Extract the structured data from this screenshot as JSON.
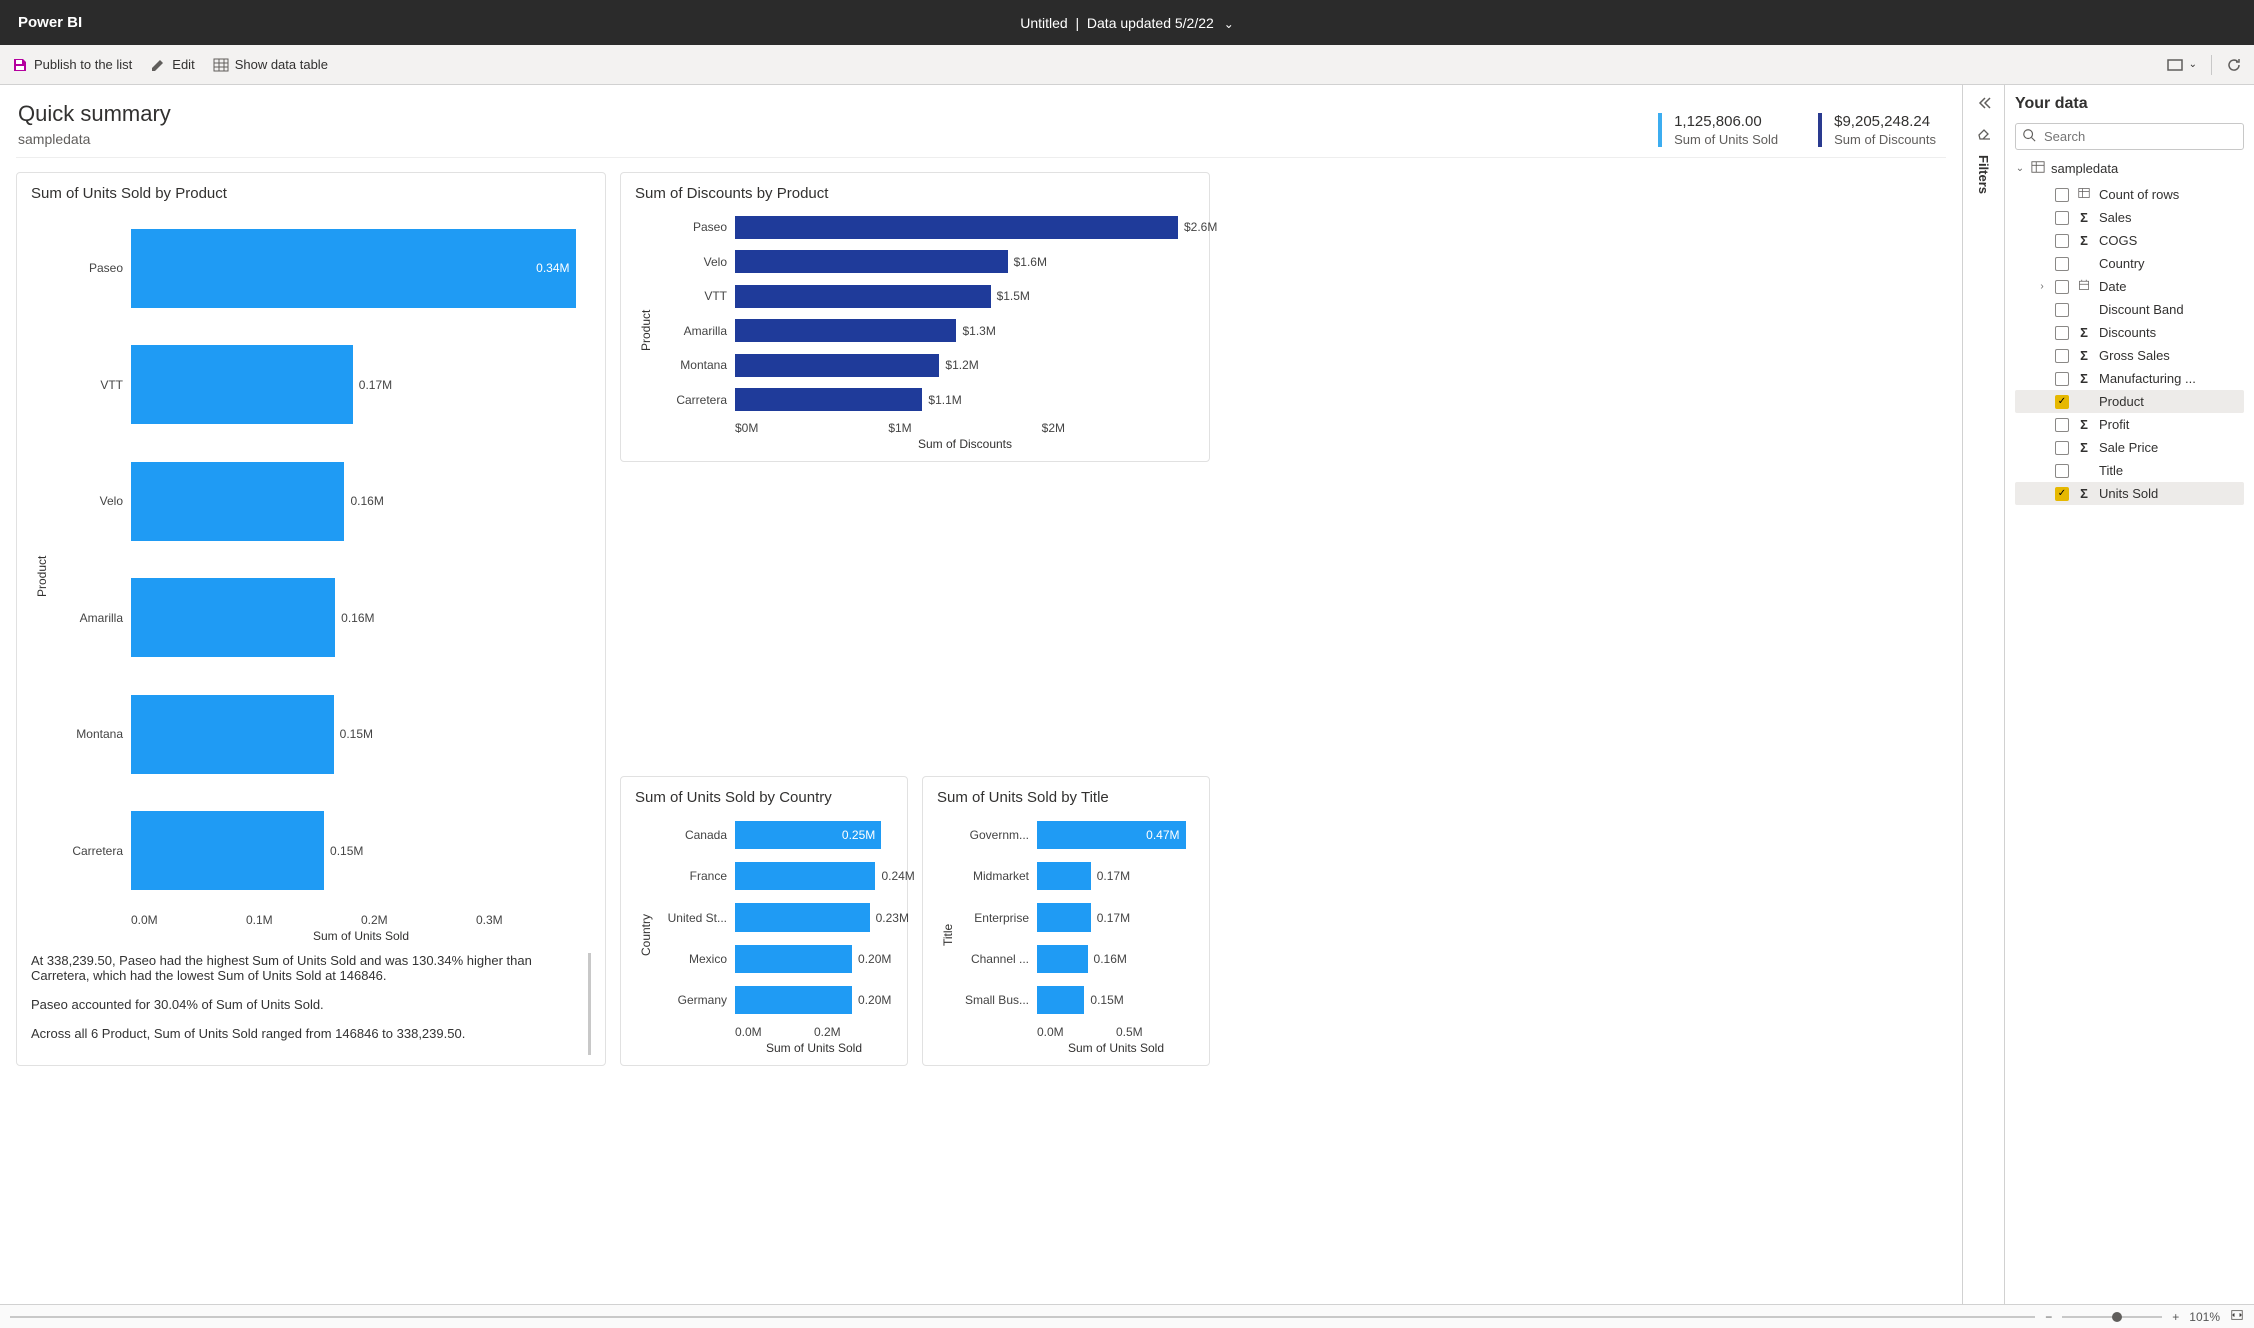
{
  "app": {
    "brand": "Power BI",
    "doc_title": "Untitled",
    "updated": "Data updated 5/2/22"
  },
  "toolbar": {
    "publish": "Publish to the list",
    "edit": "Edit",
    "show_table": "Show data table"
  },
  "header": {
    "title": "Quick summary",
    "subtitle": "sampledata",
    "kpis": [
      {
        "value": "1,125,806.00",
        "label": "Sum of Units Sold"
      },
      {
        "value": "$9,205,248.24",
        "label": "Sum of Discounts"
      }
    ]
  },
  "rail": {
    "filters_label": "Filters"
  },
  "datapane": {
    "title": "Your data",
    "search_placeholder": "Search",
    "table": "sampledata",
    "fields": [
      {
        "label": "Count of rows",
        "icon": "table",
        "checked": false,
        "expandable": false
      },
      {
        "label": "Sales",
        "icon": "sigma",
        "checked": false,
        "expandable": false
      },
      {
        "label": "COGS",
        "icon": "sigma",
        "checked": false,
        "expandable": false
      },
      {
        "label": "Country",
        "icon": "",
        "checked": false,
        "expandable": false
      },
      {
        "label": "Date",
        "icon": "calendar",
        "checked": false,
        "expandable": true
      },
      {
        "label": "Discount Band",
        "icon": "",
        "checked": false,
        "expandable": false
      },
      {
        "label": "Discounts",
        "icon": "sigma",
        "checked": false,
        "expandable": false
      },
      {
        "label": "Gross Sales",
        "icon": "sigma",
        "checked": false,
        "expandable": false
      },
      {
        "label": "Manufacturing ...",
        "icon": "sigma",
        "checked": false,
        "expandable": false
      },
      {
        "label": "Product",
        "icon": "",
        "checked": true,
        "expandable": false
      },
      {
        "label": "Profit",
        "icon": "sigma",
        "checked": false,
        "expandable": false
      },
      {
        "label": "Sale Price",
        "icon": "sigma",
        "checked": false,
        "expandable": false
      },
      {
        "label": "Title",
        "icon": "",
        "checked": false,
        "expandable": false
      },
      {
        "label": "Units Sold",
        "icon": "sigma",
        "checked": true,
        "expandable": false
      }
    ]
  },
  "insights": {
    "p1": "At 338,239.50, Paseo had the highest Sum of Units Sold and was 130.34% higher than Carretera, which had the lowest Sum of Units Sold at 146846.",
    "p2": "Paseo accounted for 30.04% of Sum of Units Sold.",
    "p3": "Across all 6 Product, Sum of Units Sold ranged from 146846 to 338,239.50."
  },
  "status": {
    "zoom_label": "101%"
  },
  "chart_data": [
    {
      "id": "units_by_product",
      "type": "bar",
      "title": "Sum of Units Sold by Product",
      "ylabel": "Product",
      "xlabel": "Sum of Units Sold",
      "color": "#1f9bf4",
      "x_ticks": [
        "0.0M",
        "0.1M",
        "0.2M",
        "0.3M"
      ],
      "xlim": [
        0,
        350000
      ],
      "categories": [
        "Paseo",
        "VTT",
        "Velo",
        "Amarilla",
        "Montana",
        "Carretera"
      ],
      "values": [
        338239.5,
        168783,
        162424,
        155315,
        154198,
        146846
      ],
      "data_labels": [
        "0.34M",
        "0.17M",
        "0.16M",
        "0.16M",
        "0.15M",
        "0.15M"
      ],
      "label_inside": [
        true,
        false,
        false,
        false,
        false,
        false
      ]
    },
    {
      "id": "discounts_by_product",
      "type": "bar",
      "title": "Sum of Discounts by Product",
      "ylabel": "Product",
      "xlabel": "Sum of Discounts",
      "color": "#1f3b9a",
      "x_ticks": [
        "$0M",
        "$1M",
        "$2M"
      ],
      "xlim": [
        0,
        2700000
      ],
      "categories": [
        "Paseo",
        "Velo",
        "VTT",
        "Amarilla",
        "Montana",
        "Carretera"
      ],
      "values": [
        2600000,
        1600000,
        1500000,
        1300000,
        1200000,
        1100000
      ],
      "data_labels": [
        "$2.6M",
        "$1.6M",
        "$1.5M",
        "$1.3M",
        "$1.2M",
        "$1.1M"
      ],
      "label_inside": [
        false,
        false,
        false,
        false,
        false,
        false
      ]
    },
    {
      "id": "units_by_country",
      "type": "bar",
      "title": "Sum of Units Sold by Country",
      "ylabel": "Country",
      "xlabel": "Sum of Units Sold",
      "color": "#1f9bf4",
      "x_ticks": [
        "0.0M",
        "0.2M"
      ],
      "xlim": [
        0,
        270000
      ],
      "categories": [
        "Canada",
        "France",
        "United St...",
        "Mexico",
        "Germany"
      ],
      "values": [
        250000,
        240000,
        230000,
        200000,
        200000
      ],
      "data_labels": [
        "0.25M",
        "0.24M",
        "0.23M",
        "0.20M",
        "0.20M"
      ],
      "label_inside": [
        true,
        false,
        false,
        false,
        false
      ]
    },
    {
      "id": "units_by_title",
      "type": "bar",
      "title": "Sum of Units Sold by Title",
      "ylabel": "Title",
      "xlabel": "Sum of Units Sold",
      "color": "#1f9bf4",
      "x_ticks": [
        "0.0M",
        "0.5M"
      ],
      "xlim": [
        0,
        500000
      ],
      "categories": [
        "Governm...",
        "Midmarket",
        "Enterprise",
        "Channel ...",
        "Small Bus..."
      ],
      "values": [
        470000,
        170000,
        170000,
        160000,
        150000
      ],
      "data_labels": [
        "0.47M",
        "0.17M",
        "0.17M",
        "0.16M",
        "0.15M"
      ],
      "label_inside": [
        true,
        false,
        false,
        false,
        false
      ]
    }
  ]
}
